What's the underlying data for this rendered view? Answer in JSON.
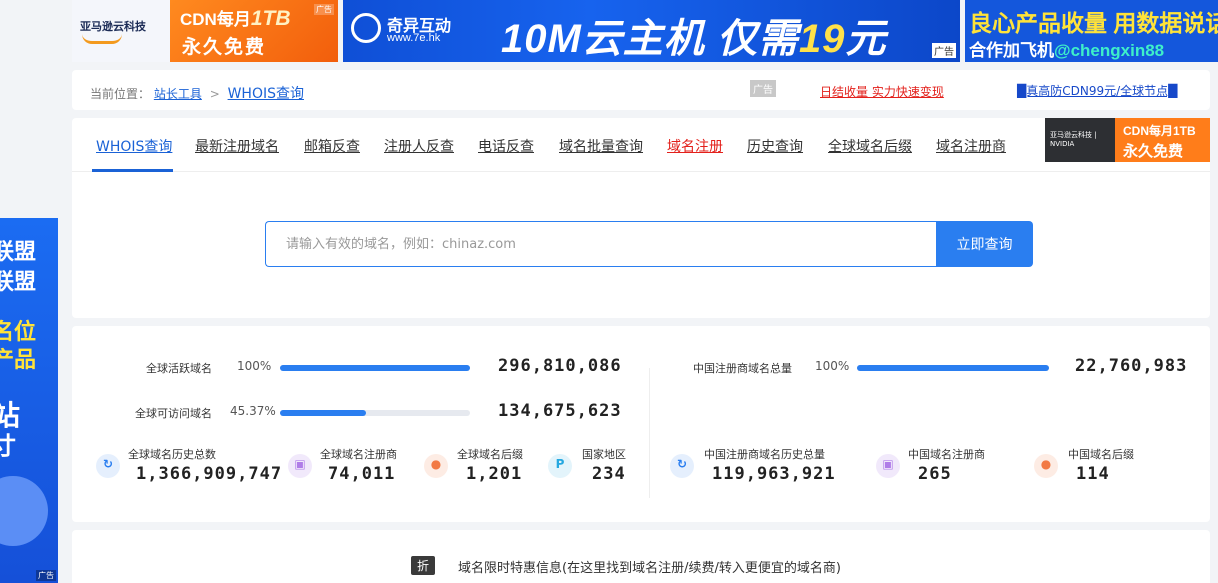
{
  "banners": {
    "b1": {
      "logo": "亚马逊云科技",
      "line1_a": "CDN每月",
      "line1_b": "1TB",
      "line2": "永久免费",
      "tag": "广告"
    },
    "b2": {
      "brand": "奇异互动",
      "brand_url": "www.7e.hk",
      "headline_a": "10M云主机 仅需",
      "headline_b": "19",
      "headline_c": "元",
      "tag": "广告"
    },
    "b3": {
      "line1": "良心产品收量 用数据说话",
      "line2_a": "合作加飞机",
      "line2_b": "@chengxin88"
    }
  },
  "breadcrumb": {
    "prefix": "当前位置：",
    "crumb1": "站长工具",
    "sep": ">",
    "current": "WHOIS查询",
    "ad_tag": "广告",
    "ad_link1": "日结收量 实力快速变现",
    "ad_link2": "█真高防CDN99元/全球节点█"
  },
  "tabs": [
    "WHOIS查询",
    "最新注册域名",
    "邮箱反查",
    "注册人反查",
    "电话反查",
    "域名批量查询",
    "域名注册",
    "历史查询",
    "全球域名后缀",
    "域名注册商"
  ],
  "tab_ad": {
    "logo": "亚马逊云科技 | NVIDIA",
    "line1": "CDN每月1TB",
    "line2": "永久免费"
  },
  "search": {
    "placeholder": "请输入有效的域名，例如：chinaz.com",
    "button": "立即查询"
  },
  "stats": {
    "active": {
      "label": "全球活跃域名",
      "pct": "100%",
      "fill": 1.0,
      "value": "296,810,086"
    },
    "accessible": {
      "label": "全球可访问域名",
      "pct": "45.37%",
      "fill": 0.4537,
      "value": "134,675,623"
    },
    "cn_total": {
      "label": "中国注册商域名总量",
      "pct": "100%",
      "fill": 1.0,
      "value": "22,760,983"
    },
    "mini": [
      {
        "label": "全球域名历史总数",
        "value": "1,366,909,747",
        "icon": "history-icon",
        "glyph": "↻"
      },
      {
        "label": "全球域名注册商",
        "value": "74,011",
        "icon": "registrar-icon",
        "glyph": "▣"
      },
      {
        "label": "全球域名后缀",
        "value": "1,201",
        "icon": "tag-icon",
        "glyph": "●"
      },
      {
        "label": "国家地区",
        "value": "234",
        "icon": "flag-icon",
        "glyph": "P"
      },
      {
        "label": "中国注册商域名历史总量",
        "value": "119,963,921",
        "icon": "history-icon",
        "glyph": "↻"
      },
      {
        "label": "中国域名注册商",
        "value": "265",
        "icon": "registrar-icon",
        "glyph": "▣"
      },
      {
        "label": "中国域名后缀",
        "value": "114",
        "icon": "tag-icon",
        "glyph": "●"
      }
    ]
  },
  "promo": {
    "badge": "折",
    "text": "域名限时特惠信息(在这里找到域名注册/续费/转入更便宜的域名商)"
  },
  "side_banner": {
    "l1": "联盟",
    "l2": "联盟",
    "l3": "名位",
    "l4": "产品",
    "l5": "站",
    "l6": "寸",
    "tag": "广告"
  },
  "colors": {
    "accent": "#2a7ef0",
    "link": "#1a62d6",
    "red": "#e3201b"
  }
}
